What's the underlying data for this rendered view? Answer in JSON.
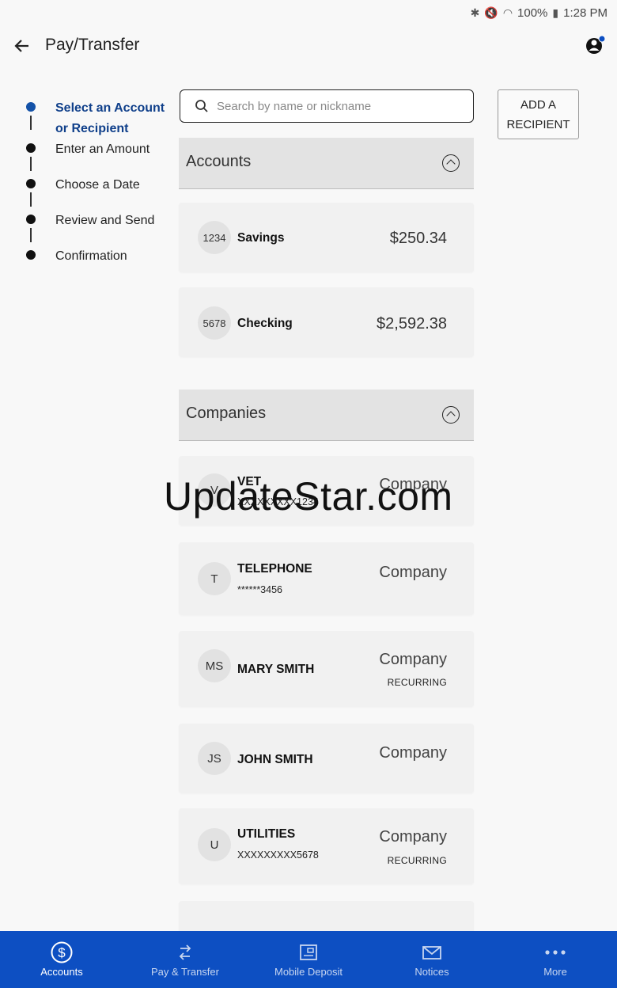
{
  "status_bar": {
    "battery": "100%",
    "time": "1:28 PM"
  },
  "app_bar": {
    "title": "Pay/Transfer"
  },
  "stepper": {
    "steps": [
      {
        "label": "Select an Account or Recipient",
        "active": true
      },
      {
        "label": "Enter an Amount"
      },
      {
        "label": "Choose a Date"
      },
      {
        "label": "Review and Send"
      },
      {
        "label": "Confirmation"
      }
    ]
  },
  "search": {
    "placeholder": "Search by name or nickname"
  },
  "add_recipient": {
    "label_line1": "ADD A",
    "label_line2": "RECIPIENT"
  },
  "accounts_section": {
    "title": "Accounts",
    "items": [
      {
        "badge": "1234",
        "name": "Savings",
        "amount": "$250.34"
      },
      {
        "badge": "5678",
        "name": "Checking",
        "amount": "$2,592.38"
      }
    ]
  },
  "companies_section": {
    "title": "Companies",
    "items": [
      {
        "initials": "V",
        "name": "VET",
        "account": "XXXXXXXXX1234",
        "type": "Company"
      },
      {
        "initials": "T",
        "name": "TELEPHONE",
        "account": "******3456",
        "type": "Company"
      },
      {
        "initials": "MS",
        "name": "MARY SMITH",
        "type": "Company",
        "tag": "RECURRING"
      },
      {
        "initials": "JS",
        "name": "JOHN SMITH",
        "type": "Company"
      },
      {
        "initials": "U",
        "name": "UTILITIES",
        "account": "XXXXXXXXX5678",
        "type": "Company",
        "tag": "RECURRING"
      }
    ]
  },
  "watermark": "UpdateStar.com",
  "bottom_nav": {
    "items": [
      {
        "label": "Accounts",
        "icon": "dollar-circle-icon",
        "active": true
      },
      {
        "label": "Pay & Transfer",
        "icon": "transfer-arrows-icon"
      },
      {
        "label": "Mobile Deposit",
        "icon": "check-deposit-icon"
      },
      {
        "label": "Notices",
        "icon": "envelope-icon"
      },
      {
        "label": "More",
        "icon": "more-dots-icon"
      }
    ]
  },
  "colors": {
    "primary": "#0d4fc2",
    "active_step": "#1452a8",
    "background": "#f8f8f8"
  }
}
